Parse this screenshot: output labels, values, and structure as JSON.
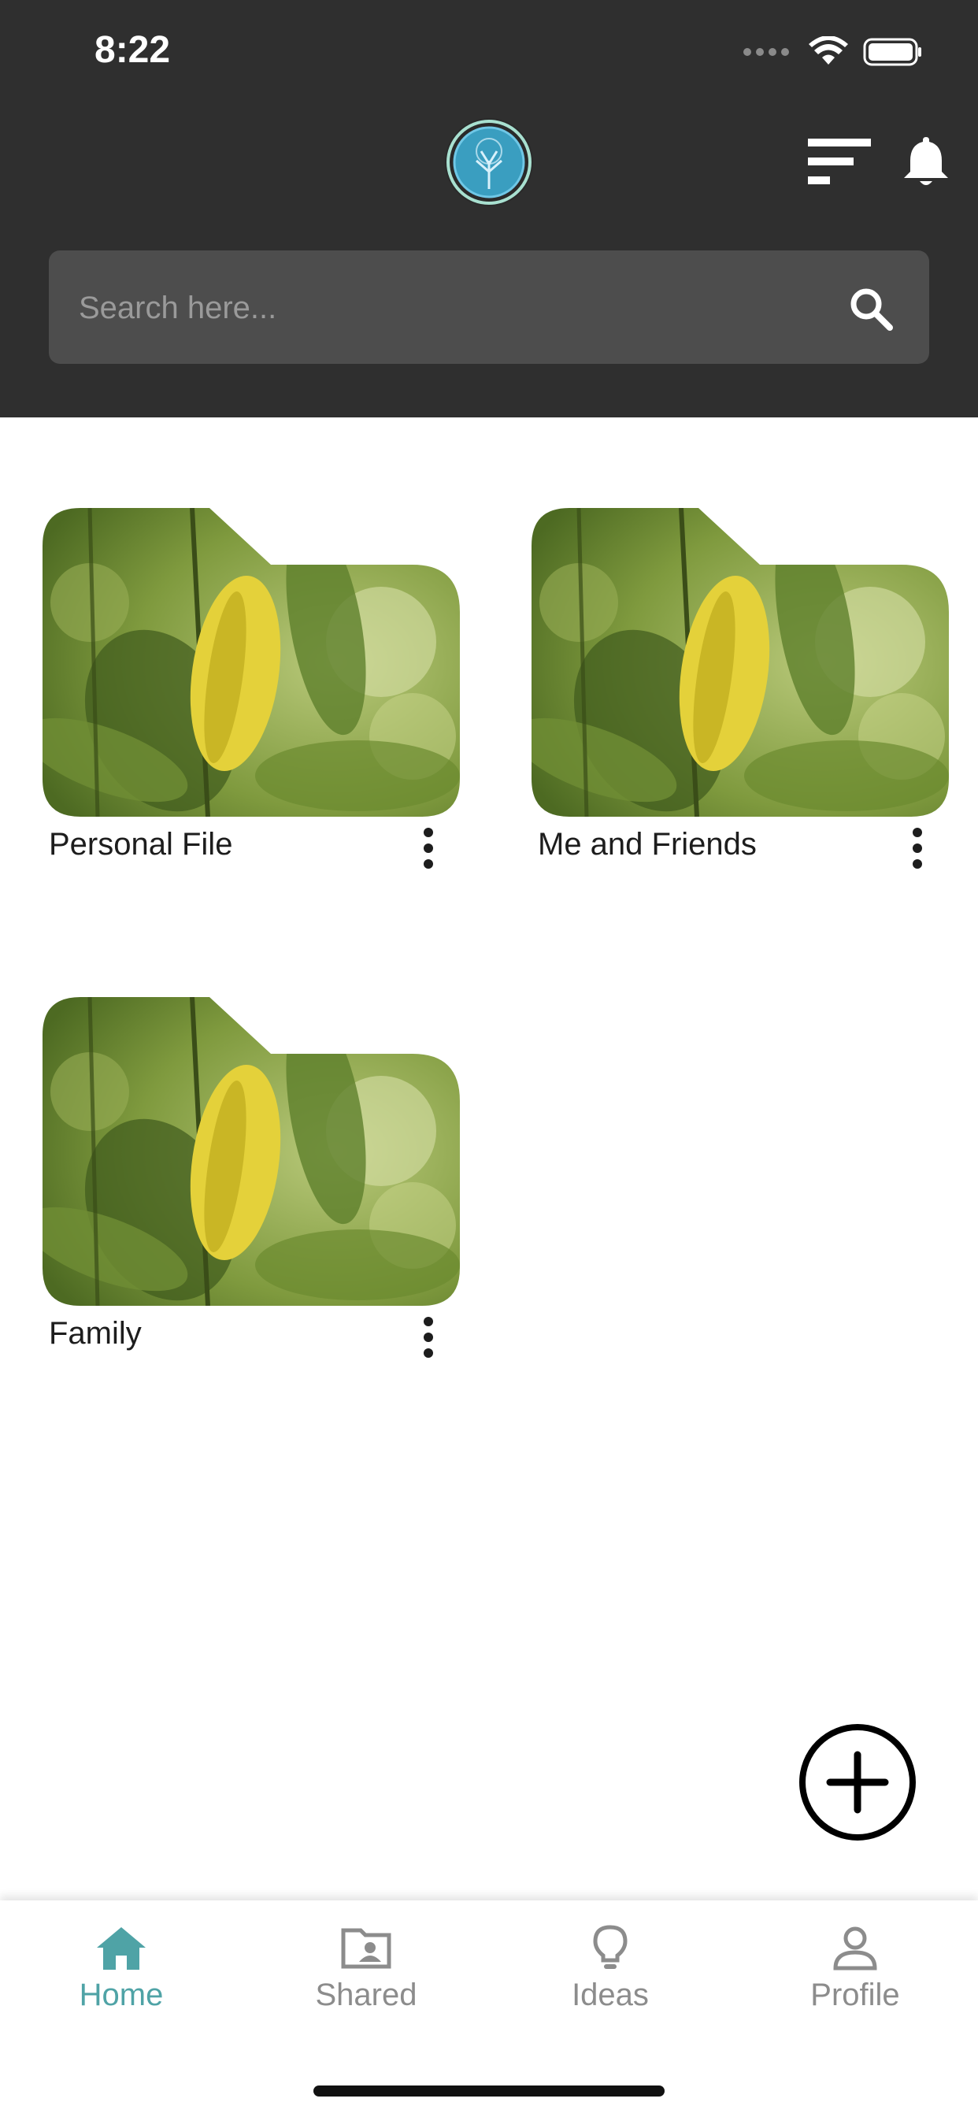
{
  "status_bar": {
    "time": "8:22"
  },
  "header": {
    "logo_icon": "tree-logo-icon",
    "sort_icon": "sort-icon",
    "notification_icon": "bell-icon"
  },
  "search": {
    "placeholder": "Search here...",
    "value": ""
  },
  "folders": [
    {
      "name": "Personal File"
    },
    {
      "name": "Me and Friends"
    },
    {
      "name": "Family"
    }
  ],
  "fab": {
    "icon": "add-circle-icon"
  },
  "tabs": [
    {
      "label": "Home",
      "icon": "home-icon",
      "active": true
    },
    {
      "label": "Shared",
      "icon": "shared-folder-icon",
      "active": false
    },
    {
      "label": "Ideas",
      "icon": "lightbulb-icon",
      "active": false
    },
    {
      "label": "Profile",
      "icon": "person-icon",
      "active": false
    }
  ],
  "colors": {
    "header_bg": "#2f2f2f",
    "search_bg": "#4d4d4d",
    "accent": "#4fa3a6",
    "inactive_tab": "#8c8c8c"
  }
}
